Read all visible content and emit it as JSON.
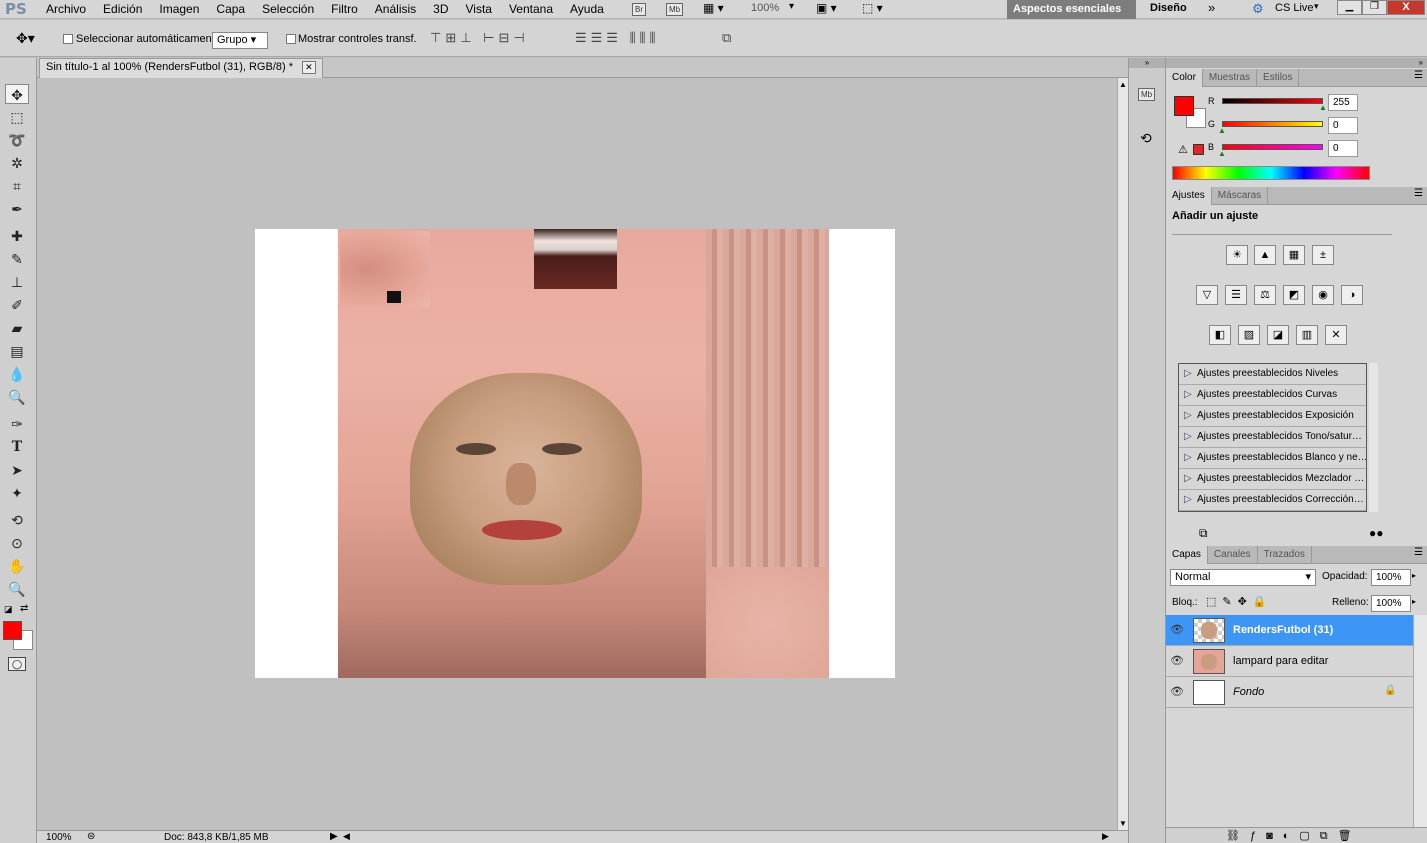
{
  "app": {
    "logo": "PS"
  },
  "menu": {
    "items": [
      "Archivo",
      "Edición",
      "Imagen",
      "Capa",
      "Selección",
      "Filtro",
      "Análisis",
      "3D",
      "Vista",
      "Ventana",
      "Ayuda"
    ],
    "br": "Br",
    "mb": "Mb",
    "zoom": "100%",
    "workspace_active": "Aspectos esenciales",
    "workspace_other": "Diseño",
    "cslive": "CS Live"
  },
  "options": {
    "auto_select": "Seleccionar automáticamente:",
    "auto_select_value": "Grupo",
    "show_transform": "Mostrar controles transf."
  },
  "document": {
    "tab_title": "Sin título-1 al 100% (RendersFutbol (31), RGB/8) *",
    "close": "✕"
  },
  "status": {
    "zoom": "100%",
    "doc": "Doc: 843,8 KB/1,85 MB"
  },
  "color_panel": {
    "tabs": [
      "Color",
      "Muestras",
      "Estilos"
    ],
    "r_label": "R",
    "g_label": "G",
    "b_label": "B",
    "r": "255",
    "g": "0",
    "b": "0",
    "fg": "#ff0000"
  },
  "adjust_panel": {
    "tabs": [
      "Ajustes",
      "Máscaras"
    ],
    "heading": "Añadir un ajuste",
    "presets": [
      "Ajustes preestablecidos Niveles",
      "Ajustes preestablecidos Curvas",
      "Ajustes preestablecidos Exposición",
      "Ajustes preestablecidos Tono/satur…",
      "Ajustes preestablecidos Blanco y ne…",
      "Ajustes preestablecidos Mezclador …",
      "Ajustes preestablecidos Corrección…"
    ]
  },
  "layers_panel": {
    "tabs": [
      "Capas",
      "Canales",
      "Trazados"
    ],
    "blend": "Normal",
    "opacity_label": "Opacidad:",
    "opacity": "100%",
    "lock_label": "Bloq.:",
    "fill_label": "Relleno:",
    "fill": "100%",
    "layers": [
      {
        "name": "RendersFutbol (31)",
        "active": true
      },
      {
        "name": "lampard para editar",
        "active": false
      },
      {
        "name": "Fondo",
        "active": false
      }
    ]
  }
}
